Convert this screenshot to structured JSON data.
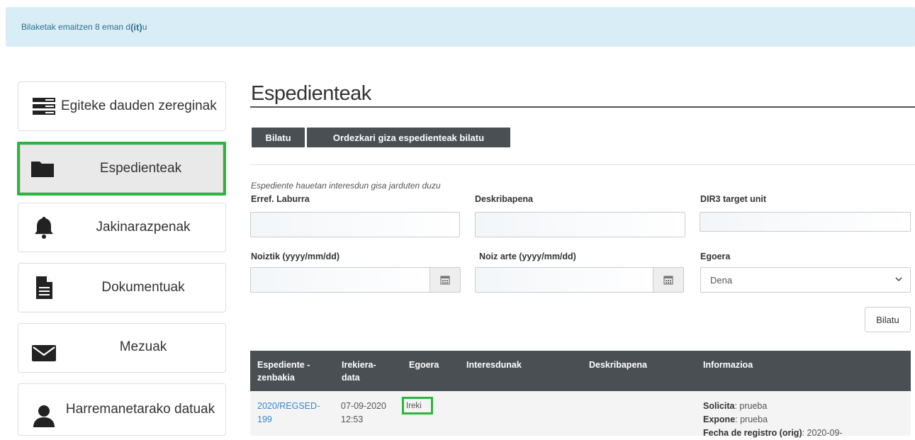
{
  "alert": {
    "prefix": "Bilaketak emaitzen 8 eman d",
    "bold": "(it)",
    "suffix": "u"
  },
  "sidebar": {
    "items": [
      {
        "label": "Egiteke dauden zereginak",
        "icon": "tasks-icon"
      },
      {
        "label": "Espedienteak",
        "icon": "folder-icon",
        "active": true
      },
      {
        "label": "Jakinarazpenak",
        "icon": "bell-icon"
      },
      {
        "label": "Dokumentuak",
        "icon": "document-icon"
      },
      {
        "label": "Mezuak",
        "icon": "envelope-icon"
      },
      {
        "label": "Harremanetarako datuak",
        "icon": "user-icon"
      }
    ]
  },
  "page": {
    "title": "Espedienteak"
  },
  "tabs": {
    "search": "Bilatu",
    "representative_search": "Ordezkari giza espedienteak bilatu"
  },
  "form": {
    "help_text": "Espediente hauetan interesdun gisa jarduten duzu",
    "ref_label": "Erref. Laburra",
    "desc_label": "Deskribapena",
    "dir3_label": "DIR3 target unit",
    "from_label": "Noiztik (yyyy/mm/dd)",
    "to_label": "Noiz arte (yyyy/mm/dd)",
    "status_label": "Egoera",
    "status_value": "Dena",
    "search_button": "Bilatu"
  },
  "table": {
    "headers": {
      "number_1": "Espediente -",
      "number_2": "zenbakia",
      "date_1": "Irekiera-",
      "date_2": "data",
      "status": "Egoera",
      "interested": "Interesdunak",
      "description": "Deskribapena",
      "info": "Informazioa"
    },
    "rows": [
      {
        "number_1": "2020/REGSED-",
        "number_2": "199",
        "date_1": "07-09-2020",
        "date_2": "12:53",
        "status": "Ireki",
        "info": [
          {
            "key": "Solicita",
            "value": ": prueba"
          },
          {
            "key": "Expone",
            "value": ": prueba"
          },
          {
            "key": "Fecha de registro (orig)",
            "value": ": 2020-09-"
          }
        ]
      }
    ]
  },
  "colors": {
    "highlight": "#2db53f",
    "dark_header": "#4a4f54",
    "alert_bg": "#d9edf7",
    "link": "#3a87c8"
  }
}
